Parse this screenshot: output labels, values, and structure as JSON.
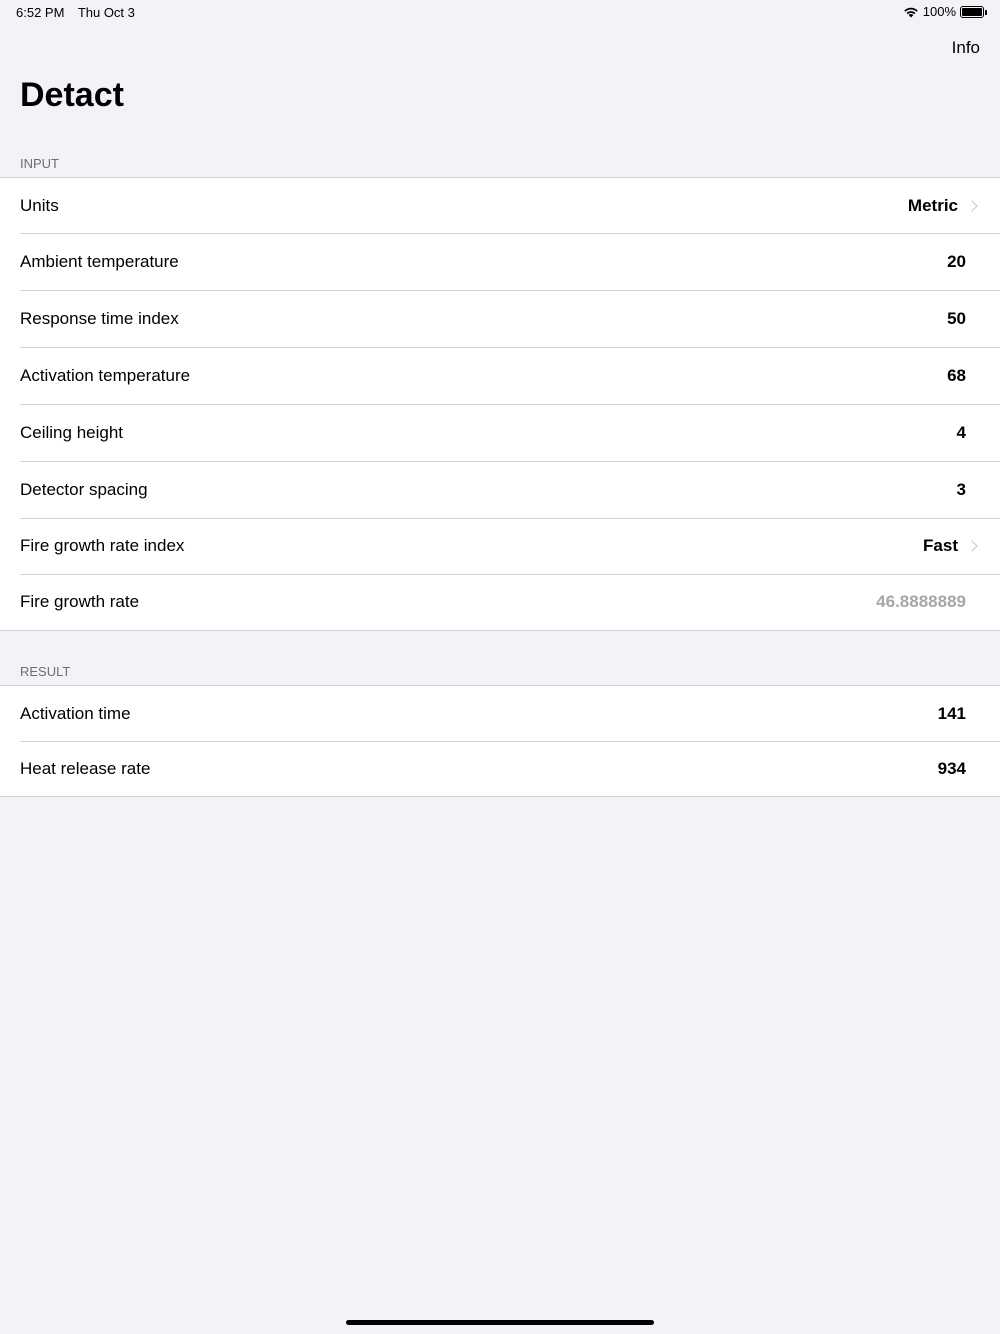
{
  "status_bar": {
    "time": "6:52 PM",
    "date": "Thu Oct 3",
    "battery_percent": "100%",
    "icons": [
      "wifi-icon",
      "battery-icon"
    ]
  },
  "nav": {
    "info_label": "Info",
    "title": "Detact"
  },
  "input_section": {
    "header": "INPUT",
    "rows": [
      {
        "label": "Units",
        "value": "Metric"
      },
      {
        "label": "Ambient temperature",
        "value": "20"
      },
      {
        "label": "Response time index",
        "value": "50"
      },
      {
        "label": "Activation temperature",
        "value": "68"
      },
      {
        "label": "Ceiling height",
        "value": "4"
      },
      {
        "label": "Detector spacing",
        "value": "3"
      },
      {
        "label": "Fire growth rate index",
        "value": "Fast"
      },
      {
        "label": "Fire growth rate",
        "value": "46.8888889"
      }
    ]
  },
  "result_section": {
    "header": "RESULT",
    "rows": [
      {
        "label": "Activation time",
        "value": "141"
      },
      {
        "label": "Heat release rate",
        "value": "934"
      }
    ]
  },
  "colors": {
    "background": "#f2f2f7",
    "separator": "#d1d1d6",
    "muted_value": "#a6a6ab",
    "section_header": "#6d6d72"
  }
}
